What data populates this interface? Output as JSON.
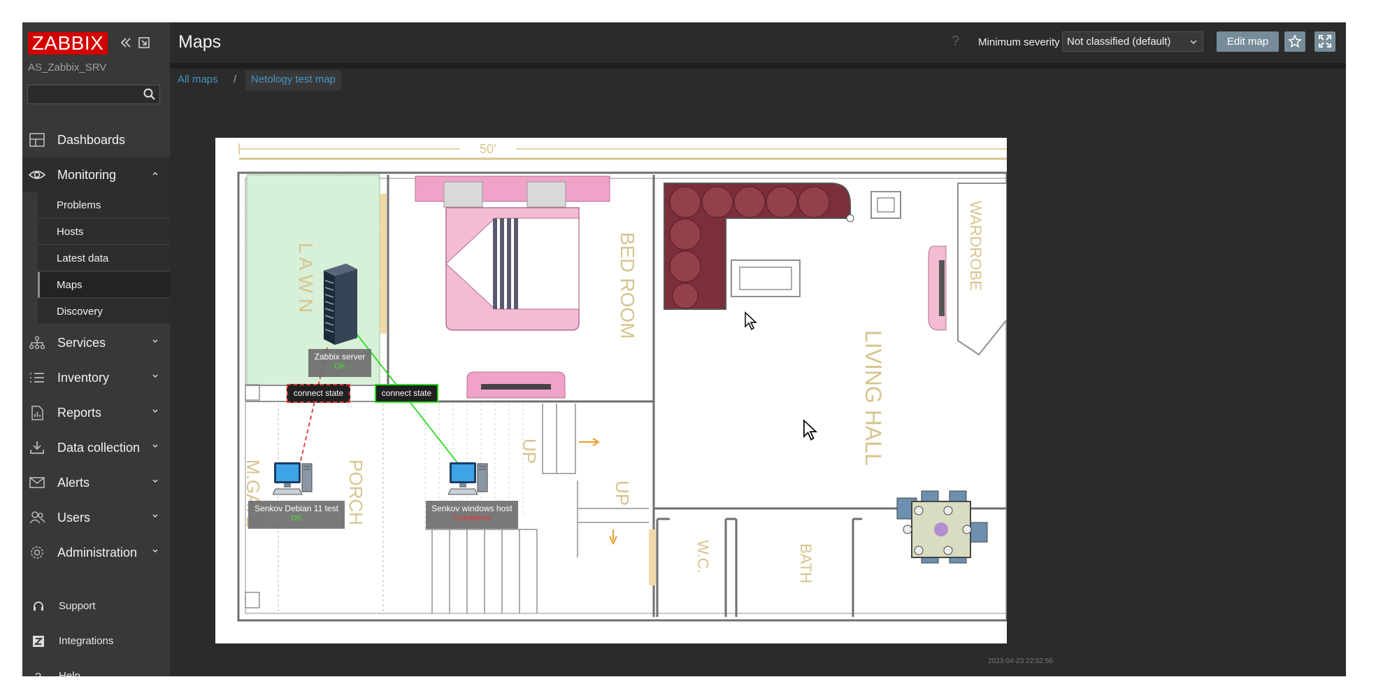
{
  "app": {
    "logo": "ZABBIX",
    "server": "AS_Zabbix_SRV"
  },
  "search": {
    "placeholder": ""
  },
  "sidebar": {
    "items": [
      {
        "label": "Dashboards"
      },
      {
        "label": "Monitoring"
      },
      {
        "label": "Services"
      },
      {
        "label": "Inventory"
      },
      {
        "label": "Reports"
      },
      {
        "label": "Data collection"
      },
      {
        "label": "Alerts"
      },
      {
        "label": "Users"
      },
      {
        "label": "Administration"
      }
    ],
    "monitoring_sub": [
      {
        "label": "Problems"
      },
      {
        "label": "Hosts"
      },
      {
        "label": "Latest data"
      },
      {
        "label": "Maps",
        "active": true
      },
      {
        "label": "Discovery"
      }
    ],
    "footer": [
      {
        "label": "Support"
      },
      {
        "label": "Integrations"
      },
      {
        "label": "Help"
      }
    ]
  },
  "header": {
    "title": "Maps",
    "help_icon": "?",
    "min_severity_label": "Minimum severity",
    "min_severity_value": "Not classified (default)",
    "edit_map_label": "Edit map"
  },
  "breadcrumb": {
    "all": "All maps",
    "separator": "/",
    "current": "Netology test map"
  },
  "map": {
    "timestamp": "2023-04-23 22:52:56",
    "nodes": [
      {
        "name": "Zabbix server",
        "status": "OK",
        "status_color": "#4cd932"
      },
      {
        "name": "Senkov Debian 11 test",
        "status": "OK",
        "status_color": "#4cd932"
      },
      {
        "name": "Senkov windows host",
        "status": "3 problems",
        "status_color": "#e33734"
      }
    ],
    "links": [
      {
        "label": "connect state",
        "color": "#e33734",
        "style": "dashed"
      },
      {
        "label": "connect state",
        "color": "#2bd920",
        "style": "solid"
      }
    ],
    "floorplan": {
      "dimension": "50'",
      "rooms": [
        "L A W N",
        "BED ROOM",
        "LIVING HALL",
        "WARDROBE",
        "M.GATE",
        "PORCH",
        "UP",
        "UP",
        "W.C.",
        "BATH"
      ]
    }
  },
  "colors": {
    "sidebar_bg": "#383838",
    "page_bg": "#2b2b2b",
    "accent_link": "#4796c4",
    "button_bg": "#768d99",
    "logo_red": "#d40000",
    "ok_green": "#4cd932",
    "problem_red": "#e33734"
  }
}
